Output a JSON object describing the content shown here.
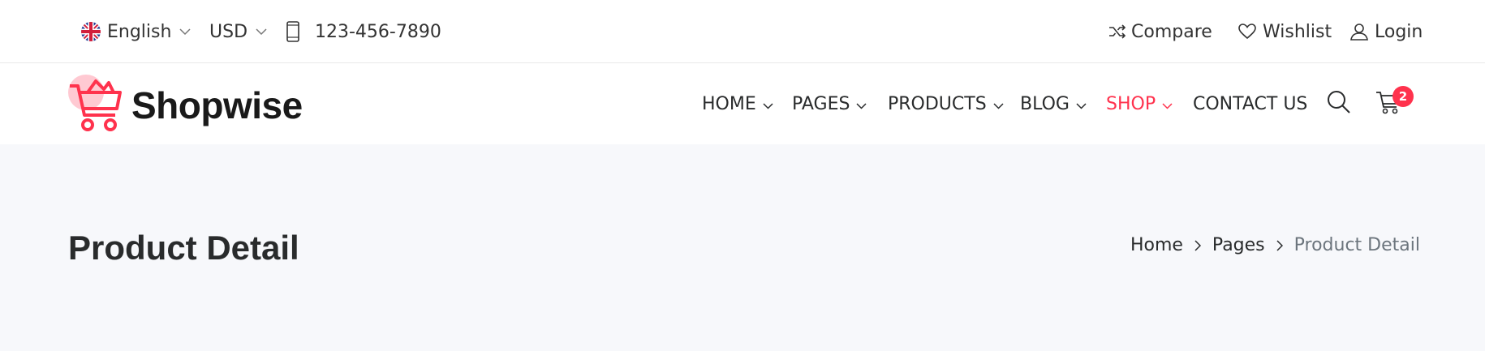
{
  "topbar": {
    "language": {
      "label": "English",
      "icon": "uk-flag-icon"
    },
    "currency": {
      "label": "USD"
    },
    "phone": {
      "number": "123-456-7890",
      "icon": "mobile-phone-icon"
    },
    "compare": {
      "label": "Compare",
      "icon": "shuffle-icon"
    },
    "wishlist": {
      "label": "Wishlist",
      "icon": "heart-icon"
    },
    "login": {
      "label": "Login",
      "icon": "user-icon"
    }
  },
  "header": {
    "logo_text": "Shopwise",
    "nav": [
      {
        "label": "HOME",
        "dropdown": true,
        "active": false
      },
      {
        "label": "PAGES",
        "dropdown": true,
        "active": false
      },
      {
        "label": "PRODUCTS",
        "dropdown": true,
        "active": false
      },
      {
        "label": "BLOG",
        "dropdown": true,
        "active": false
      },
      {
        "label": "SHOP",
        "dropdown": true,
        "active": true
      },
      {
        "label": "CONTACT US",
        "dropdown": false,
        "active": false
      }
    ],
    "search_icon": "search-icon",
    "cart": {
      "icon": "cart-icon",
      "count": "2"
    }
  },
  "hero": {
    "title": "Product Detail",
    "breadcrumb": {
      "home": "Home",
      "pages": "Pages",
      "current": "Product Detail"
    }
  },
  "colors": {
    "accent": "#ff324d",
    "hero_bg": "#f7f8fb",
    "text": "#292b2c",
    "muted": "#6c757d"
  }
}
